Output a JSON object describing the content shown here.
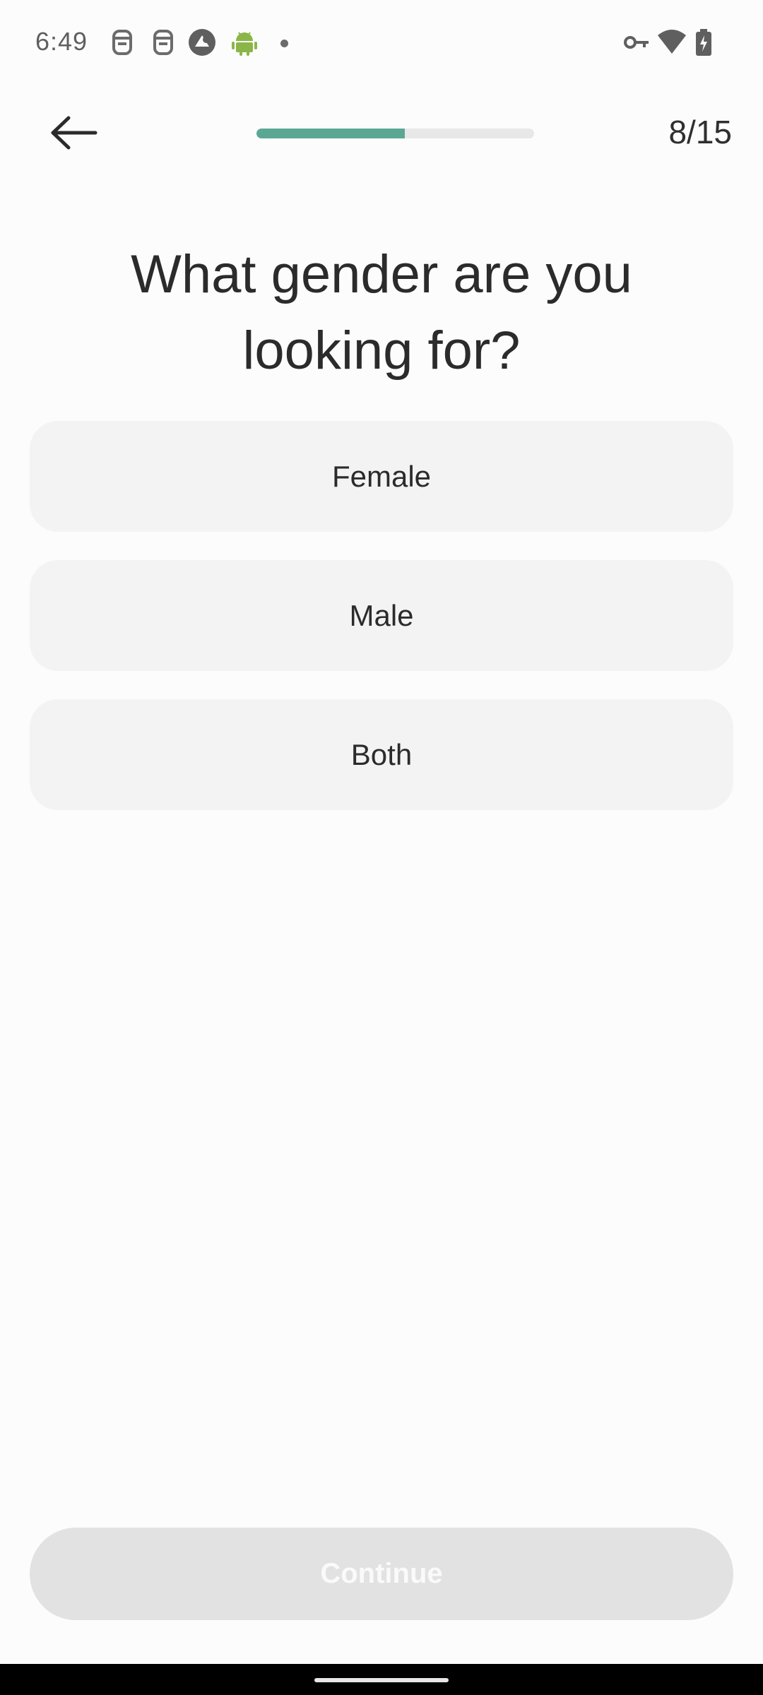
{
  "status_bar": {
    "time": "6:49",
    "icons": [
      "sim-face-icon",
      "sim-face-icon",
      "photo-app-icon",
      "android-icon",
      "dot-icon",
      "key-icon",
      "wifi-icon",
      "battery-charging-icon"
    ]
  },
  "header": {
    "back_icon": "arrow-left-icon",
    "progress_fraction": 0.5333,
    "step_counter": "8/15"
  },
  "question": {
    "title": "What gender are you looking for?"
  },
  "options": [
    {
      "label": "Female"
    },
    {
      "label": "Male"
    },
    {
      "label": "Both"
    }
  ],
  "footer": {
    "continue_label": "Continue",
    "continue_enabled": false
  },
  "colors": {
    "accent": "#5aa894",
    "progress_track": "#e8e8e8",
    "option_bg": "#f3f3f3",
    "disabled_button": "#e2e2e2"
  }
}
